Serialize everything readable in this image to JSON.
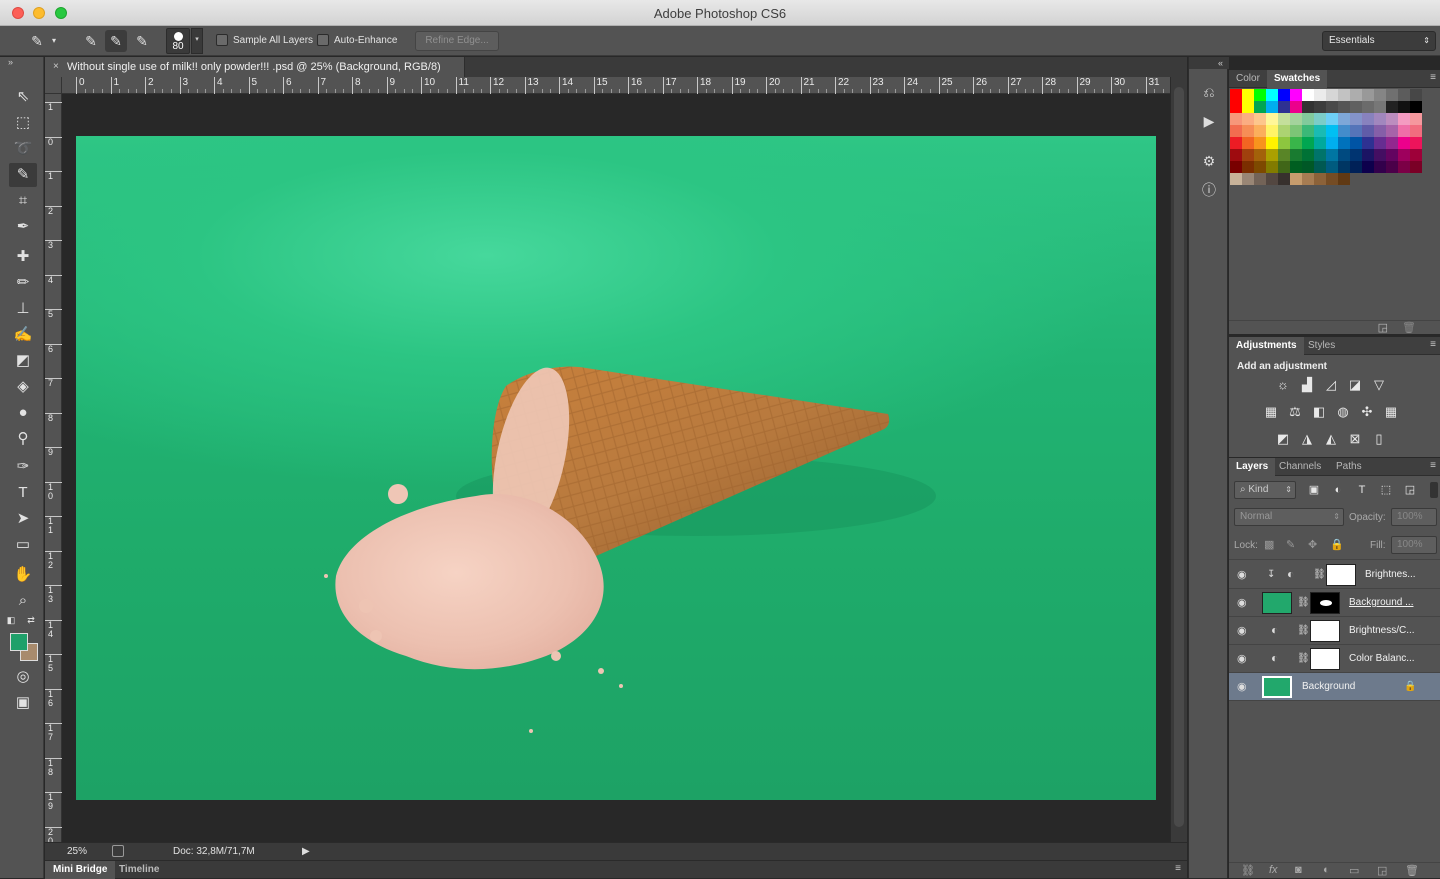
{
  "window": {
    "title": "Adobe Photoshop CS6"
  },
  "options_bar": {
    "brush_size": "80",
    "sample_all_layers": "Sample All Layers",
    "auto_enhance": "Auto-Enhance",
    "refine_edge": "Refine Edge...",
    "workspace": "Essentials"
  },
  "document": {
    "tab_title": "Without single use of milk!! only powder!!! .psd @ 25% (Background, RGB/8)",
    "close_glyph": "×",
    "ruler_top": [
      "0",
      "1",
      "2",
      "3",
      "4",
      "5",
      "6",
      "7",
      "8",
      "9",
      "10",
      "11",
      "12",
      "13",
      "14",
      "15",
      "16",
      "17",
      "18",
      "19",
      "20",
      "21",
      "22",
      "23",
      "24",
      "25",
      "26",
      "27",
      "28",
      "29",
      "30",
      "31"
    ],
    "ruler_left": [
      "1",
      "0",
      "1",
      "2",
      "3",
      "4",
      "5",
      "6",
      "7",
      "8",
      "9",
      "1 0",
      "1 1",
      "1 2",
      "1 3",
      "1 4",
      "1 5",
      "1 6",
      "1 7",
      "1 8",
      "1 9",
      "2 0"
    ]
  },
  "status": {
    "zoom": "25%",
    "doc_info": "Doc: 32,8M/71,7M"
  },
  "bottom_tabs": {
    "mini_bridge": "Mini Bridge",
    "timeline": "Timeline"
  },
  "panels": {
    "color_tab": "Color",
    "swatches_tab": "Swatches",
    "adjustments_tab": "Adjustments",
    "styles_tab": "Styles",
    "add_adjustment": "Add an adjustment",
    "layers_tab": "Layers",
    "channels_tab": "Channels",
    "paths_tab": "Paths",
    "kind": "Kind",
    "blend_mode": "Normal",
    "opacity_label": "Opacity:",
    "opacity_value": "100%",
    "lock_label": "Lock:",
    "fill_label": "Fill:",
    "fill_value": "100%"
  },
  "layers": [
    {
      "name": "Brightnes...",
      "selected": false
    },
    {
      "name": "Background ...",
      "selected": false
    },
    {
      "name": "Brightness/C...",
      "selected": false
    },
    {
      "name": "Color Balanc...",
      "selected": false
    },
    {
      "name": "Background",
      "selected": true
    }
  ],
  "colors": {
    "fg": "#1fa06a",
    "bg": "#a88b6d",
    "canvas": "#22b573"
  }
}
